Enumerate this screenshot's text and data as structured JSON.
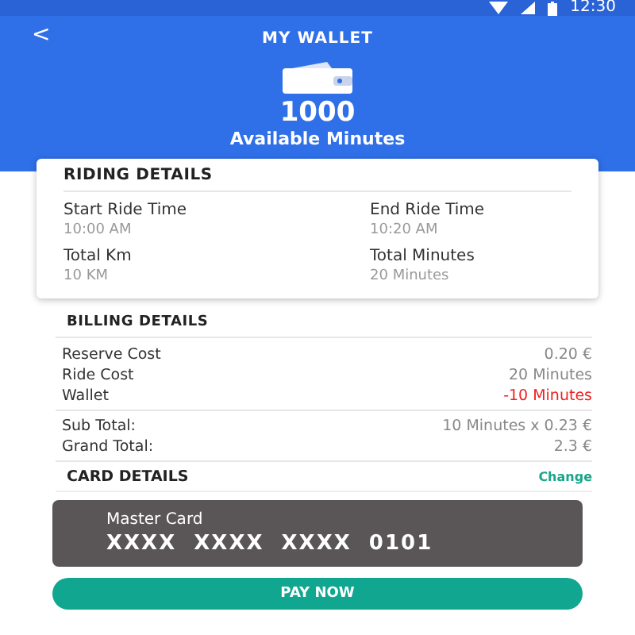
{
  "status_bar": {
    "time": "12:30"
  },
  "header": {
    "back": "<",
    "title": "MY WALLET",
    "amount": "1000",
    "amount_label": "Available Minutes"
  },
  "riding_details": {
    "title": "RIDING DETAILS",
    "fields": [
      {
        "label": "Start Ride Time",
        "value": "10:00 AM"
      },
      {
        "label": "End Ride Time",
        "value": "10:20 AM"
      },
      {
        "label": "Total Km",
        "value": "10 KM"
      },
      {
        "label": "Total Minutes",
        "value": "20 Minutes"
      }
    ]
  },
  "billing_details": {
    "title": "BILLING DETAILS",
    "rows": [
      {
        "label": "Reserve Cost",
        "value": "0.20 €",
        "kind": "normal"
      },
      {
        "label": "Ride Cost",
        "value": "20 Minutes",
        "kind": "normal"
      },
      {
        "label": "Wallet",
        "value": "-10 Minutes",
        "kind": "debit"
      }
    ],
    "totals": [
      {
        "label": "Sub Total:",
        "value": "10 Minutes x 0.23 €"
      },
      {
        "label": "Grand Total:",
        "value": "2.3 €"
      }
    ]
  },
  "card_details": {
    "title": "CARD DETAILS",
    "action": "Change",
    "card_name": "Master Card",
    "card_number": "XXXX  XXXX  XXXX  0101"
  },
  "pay_button": "PAY NOW"
}
